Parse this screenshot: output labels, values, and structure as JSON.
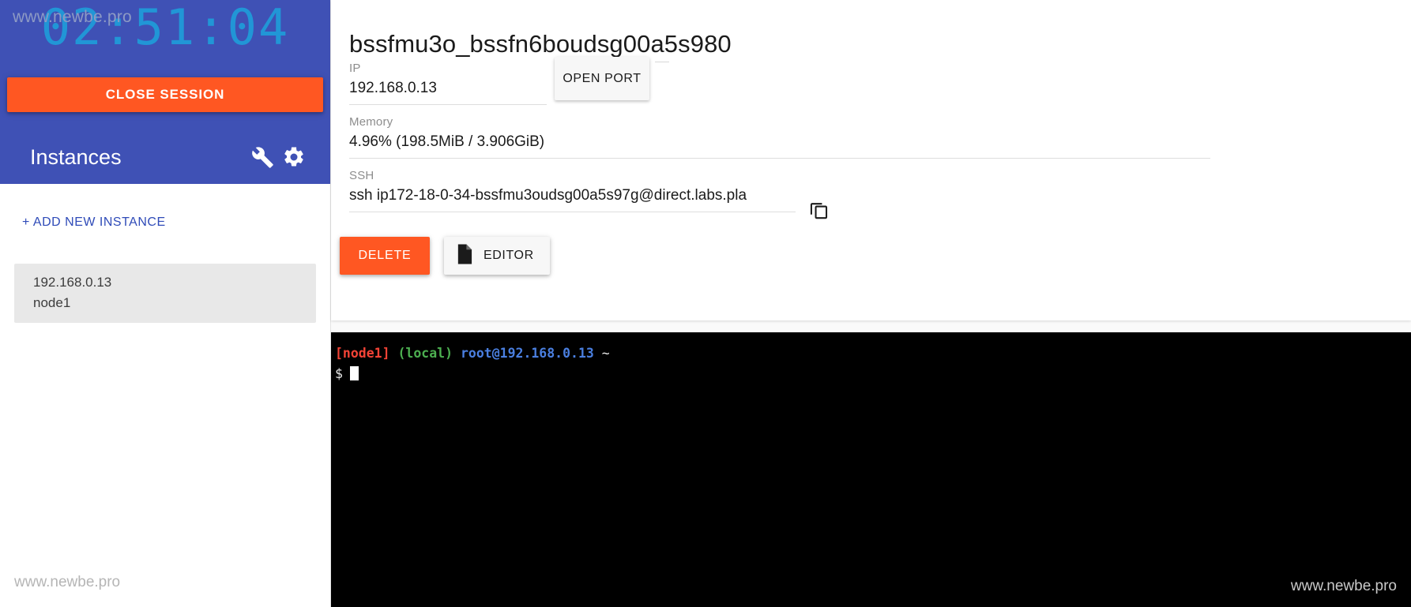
{
  "colors": {
    "sidebar_bg": "#3f51b5",
    "accent_orange": "#ff5722",
    "timer_blue": "#2196d6",
    "link_blue": "#2f4bb8",
    "terminal_bg": "#000000"
  },
  "sidebar": {
    "watermark_top": "www.newbe.pro",
    "timer": "02:51:04",
    "close_session_label": "CLOSE SESSION",
    "instances_title": "Instances",
    "wrench_icon": "wrench-icon",
    "gear_icon": "gear-icon",
    "add_instance_label": "+ ADD NEW INSTANCE",
    "instances": [
      {
        "ip": "192.168.0.13",
        "name": "node1"
      }
    ],
    "watermark_bottom": "www.newbe.pro"
  },
  "detail": {
    "title": "bssfmu3o_bssfn6boudsg00a5s980",
    "fields": {
      "ip": {
        "label": "IP",
        "value": "192.168.0.13"
      },
      "memory": {
        "label": "Memory",
        "value": "4.96% (198.5MiB / 3.906GiB)"
      },
      "ssh": {
        "label": "SSH",
        "value": "ssh ip172-18-0-34-bssfmu3oudsg00a5s97g@direct.labs.pla"
      }
    },
    "open_port_label": "OPEN PORT",
    "copy_icon": "copy-icon",
    "delete_label": "DELETE",
    "editor_label": "EDITOR",
    "editor_icon": "document-icon"
  },
  "terminal": {
    "host": "[node1]",
    "scope": "(local)",
    "user": "root@192.168.0.13",
    "cwd": "~",
    "prompt": "$",
    "watermark": "www.newbe.pro"
  }
}
